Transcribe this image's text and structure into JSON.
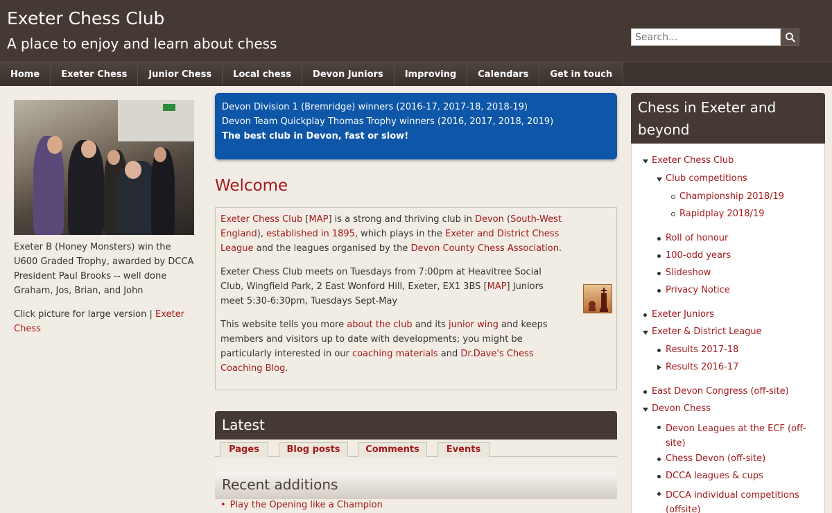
{
  "header": {
    "title": "Exeter Chess Club",
    "slogan": "A place to enjoy and learn about chess",
    "search_placeholder": "Search..."
  },
  "nav": [
    "Home",
    "Exeter Chess",
    "Junior Chess",
    "Local chess",
    "Devon Juniors",
    "Improving",
    "Calendars",
    "Get in touch"
  ],
  "left": {
    "caption": "Exeter B (Honey Monsters) win the U600 Graded Trophy, awarded by DCCA President Paul Brooks -- well done Graham, Jos, Brian, and John",
    "click_text": "Click picture for large version |",
    "click_link": "Exeter Chess"
  },
  "banner": {
    "line1": "Devon Division 1 (Bremridge) winners (2016-17, 2017-18, 2018-19)",
    "line2": "Devon Team Quickplay Thomas Trophy winners (2016, 2017, 2018, 2019)",
    "line3": "The best club in Devon, fast or slow!"
  },
  "welcome": {
    "title": "Welcome",
    "p1": {
      "l_club": "Exeter Chess Club",
      "t_open1": " [",
      "l_map": "MAP",
      "t_close1": "] is a strong and thriving club in ",
      "l_devon": "Devon",
      "t_open2": " (",
      "l_sw": "South-West England",
      "t_close2": "), ",
      "l_est": "established in 1895",
      "t_plays": ", which plays in the ",
      "l_league": "Exeter and District Chess League",
      "t_and": " and the leagues organised by the ",
      "l_dcca": "Devon County Chess Association",
      "t_end": "."
    },
    "p2": {
      "t_start": "Exeter Chess Club meets on Tuesdays from 7:00pm at Heavitree Social Club, Wingfield Park, 2 East Wonford Hill, Exeter, EX1 3BS [",
      "l_map": "MAP",
      "t_end": "] Juniors meet 5:30-6:30pm, Tuesdays Sept-May"
    },
    "p3": {
      "t1": "This website tells you more ",
      "l_about": "about the club",
      "t2": " and its ",
      "l_junior": "junior wing",
      "t3": " and keeps members and visitors up to date with developments; you might be particularly interested in our ",
      "l_coaching": "coaching materials",
      "t4": " and ",
      "l_blog": "Dr.Dave's Chess Coaching Blog",
      "t5": "."
    }
  },
  "latest": {
    "title": "Latest",
    "tabs": [
      "Pages",
      "Blog posts",
      "Comments",
      "Events"
    ]
  },
  "recent": {
    "title": "Recent additions",
    "item": "Play the Opening like a Champion"
  },
  "sidebar": {
    "title": "Chess in Exeter and beyond",
    "items": [
      "Exeter Chess Club",
      "Club competitions",
      "Championship 2018/19",
      "Rapidplay 2018/19",
      "Roll of honour",
      "100-odd years",
      "Slideshow",
      "Privacy Notice",
      "Exeter Juniors",
      "Exeter & District League",
      "Results 2017-18",
      "Results 2016-17",
      "East Devon Congress (off-site)",
      "Devon Chess",
      "Devon Leagues at the ECF (off-site)",
      "Chess Devon (off-site)",
      "DCCA leagues & cups",
      "DCCA individual competitions (offsite)"
    ]
  }
}
